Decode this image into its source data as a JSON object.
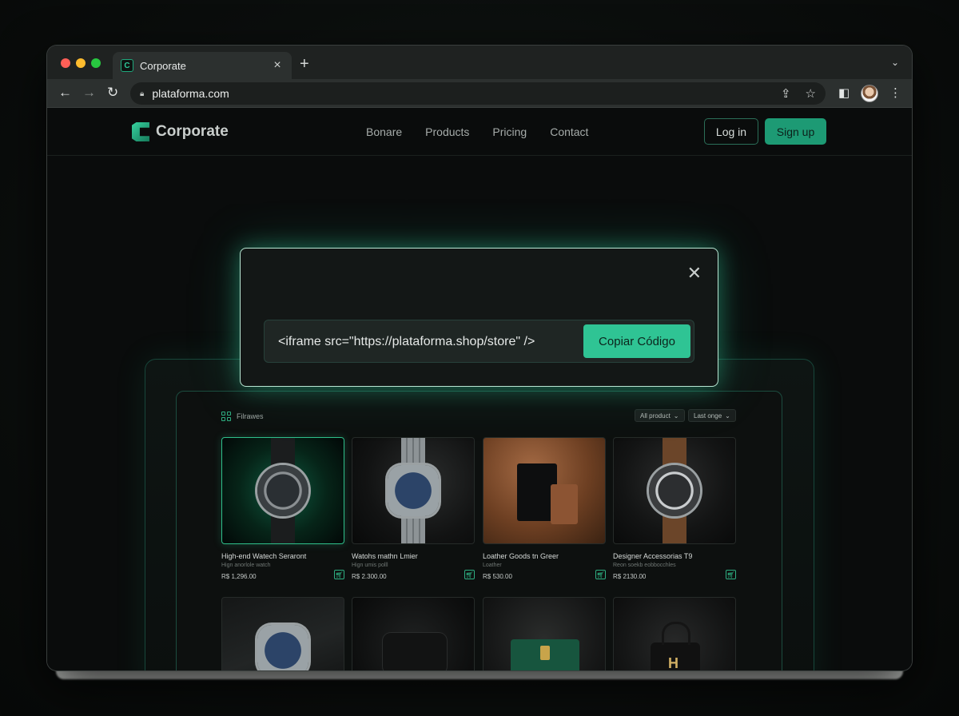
{
  "browser": {
    "tab_title": "Corporate",
    "url": "plataforma.com"
  },
  "site": {
    "brand": "Corporate",
    "nav": [
      "Bonare",
      "Products",
      "Pricing",
      "Contact"
    ],
    "login_label": "Log in",
    "signup_label": "Sign up"
  },
  "modal": {
    "code": "<iframe src=\"https://plataforma.shop/store\" />",
    "copy_label": "Copiar Código"
  },
  "store": {
    "title": "Filrawes",
    "filters": [
      {
        "label": "All product"
      },
      {
        "label": "Last onge"
      }
    ],
    "products": [
      {
        "name": "High-end Watech Seraront",
        "sub": "Hign anorlole watch",
        "price": "R$ 1,296.00"
      },
      {
        "name": "Watohs mathn Lmier",
        "sub": "Hign umis polll",
        "price": "R$ 2.300.00"
      },
      {
        "name": "Loather Goods tn Greer",
        "sub": "Loather",
        "price": "R$ 530.00"
      },
      {
        "name": "Designer Accessorias T9",
        "sub": "Reon soekb eobbocchles",
        "price": "R$ 2130.00"
      }
    ]
  },
  "colors": {
    "accent": "#2fc494",
    "modal_border": "#b9e6d3",
    "page_bg": "#0a0c0c"
  }
}
